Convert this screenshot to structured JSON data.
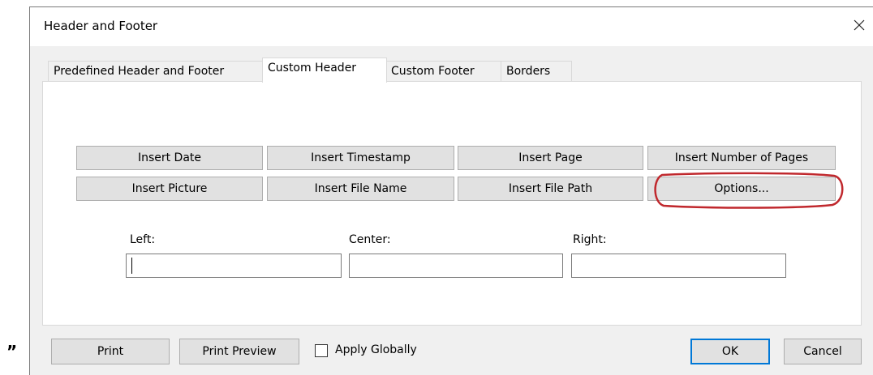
{
  "window": {
    "title": "Header and Footer",
    "close_icon": "close-icon"
  },
  "outside_text": "”",
  "tabs": [
    {
      "label": "Predefined Header and Footer",
      "active": false
    },
    {
      "label": "Custom Header",
      "active": true
    },
    {
      "label": "Custom Footer",
      "active": false
    },
    {
      "label": "Borders",
      "active": false
    }
  ],
  "insert_buttons": [
    {
      "label": "Insert Date"
    },
    {
      "label": "Insert Timestamp"
    },
    {
      "label": "Insert Page"
    },
    {
      "label": "Insert Number of Pages"
    },
    {
      "label": "Insert Picture"
    },
    {
      "label": "Insert File Name"
    },
    {
      "label": "Insert File Path"
    },
    {
      "label": "Options..."
    }
  ],
  "fields": {
    "left_label": "Left:",
    "center_label": "Center:",
    "right_label": "Right:",
    "left_value": "",
    "center_value": "",
    "right_value": ""
  },
  "footer": {
    "print_label": "Print",
    "print_preview_label": "Print Preview",
    "apply_globally_label": "Apply Globally",
    "apply_globally_checked": false,
    "ok_label": "OK",
    "cancel_label": "Cancel"
  },
  "colors": {
    "highlight_ring": "#c0282d",
    "default_button_border": "#0078d7",
    "dialog_background": "#f0f0f0",
    "button_background": "#e1e1e1"
  }
}
